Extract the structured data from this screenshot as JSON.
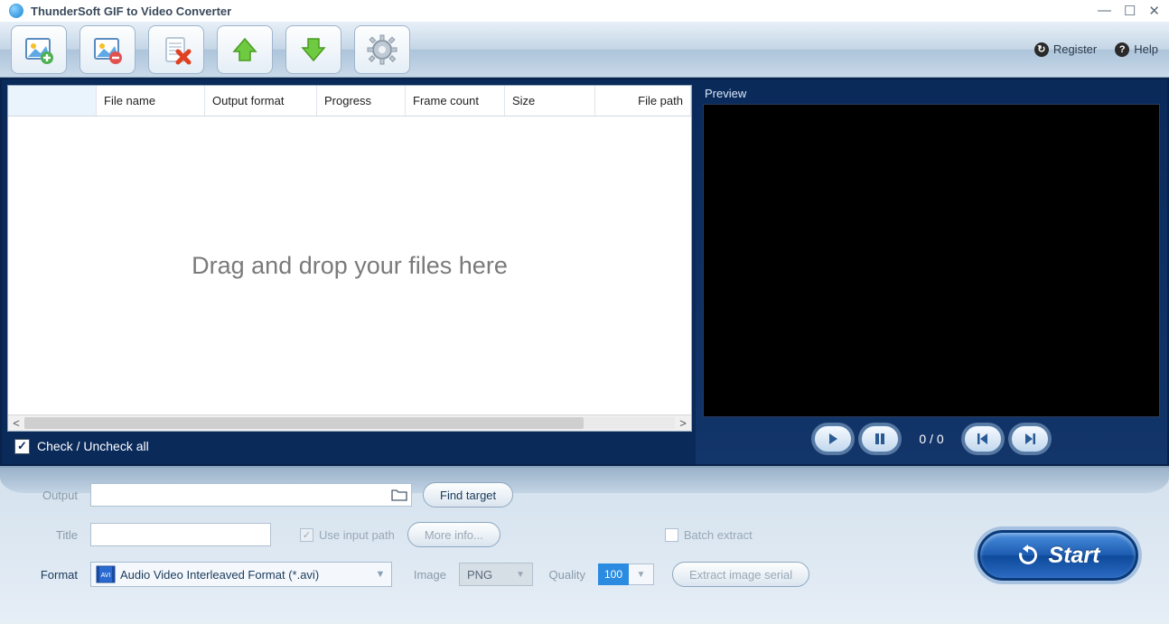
{
  "app": {
    "title": "ThunderSoft GIF to Video Converter"
  },
  "toolbar": {
    "register": "Register",
    "help": "Help"
  },
  "table": {
    "columns": [
      "",
      "File name",
      "Output format",
      "Progress",
      "Frame count",
      "Size",
      "File path"
    ],
    "drop_hint": "Drag and drop your files here",
    "check_all": "Check / Uncheck all"
  },
  "preview": {
    "label": "Preview",
    "counter": "0 / 0"
  },
  "form": {
    "output_label": "Output",
    "output_value": "",
    "find_target": "Find target",
    "title_label": "Title",
    "title_value": "",
    "use_input_path": "Use input path",
    "more_info": "More info...",
    "format_label": "Format",
    "format_value": "Audio Video Interleaved Format (*.avi)",
    "image_label": "Image",
    "image_value": "PNG",
    "quality_label": "Quality",
    "quality_value": "100",
    "batch_extract": "Batch extract",
    "extract_serial": "Extract image serial",
    "start": "Start"
  }
}
